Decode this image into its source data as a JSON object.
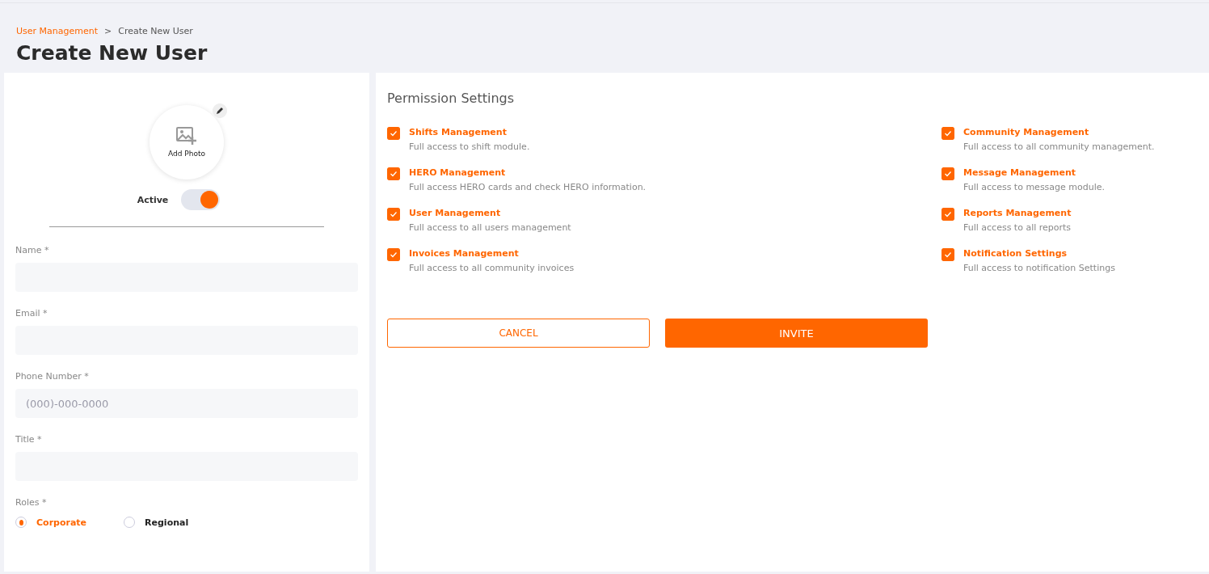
{
  "breadcrumb": [
    {
      "label": "User Management",
      "link": true
    },
    {
      "label": "Create New User",
      "link": false
    }
  ],
  "breadcrumb_separator": ">",
  "title": "Create New User",
  "profile": {
    "photo_label": "Add Photo",
    "active_label": "Active",
    "active": true
  },
  "fields": [
    {
      "label": "Name *"
    },
    {
      "label": "Email *"
    },
    {
      "label": "Phone Number *",
      "placeholder": "(000)-000-0000"
    },
    {
      "label": "Title *"
    }
  ],
  "roles": {
    "label": "Roles *",
    "options": [
      {
        "label": "Corporate",
        "selected": true
      },
      {
        "label": "Regional",
        "selected": false
      }
    ]
  },
  "permissions": {
    "title": "Permission Settings",
    "items": [
      {
        "name": "Shifts Management",
        "description": "Full access to shift module.",
        "checked": true
      },
      {
        "name": "Community Management",
        "description": "Full access to all community management.",
        "checked": true
      },
      {
        "name": "HERO Management",
        "description": "Full access HERO cards and check HERO information.",
        "checked": true
      },
      {
        "name": "Message Management",
        "description": "Full access to message module.",
        "checked": true
      },
      {
        "name": "User Management",
        "description": "Full access to all users management",
        "checked": true
      },
      {
        "name": "Reports Management",
        "description": "Full access to all reports",
        "checked": true
      },
      {
        "name": "Invoices Management",
        "description": "Full access to all community invoices",
        "checked": true
      },
      {
        "name": "Notification Settings",
        "description": "Full access to notification Settings",
        "checked": true
      }
    ]
  },
  "buttons": {
    "cancel": "CANCEL",
    "invite": "INVITE"
  }
}
